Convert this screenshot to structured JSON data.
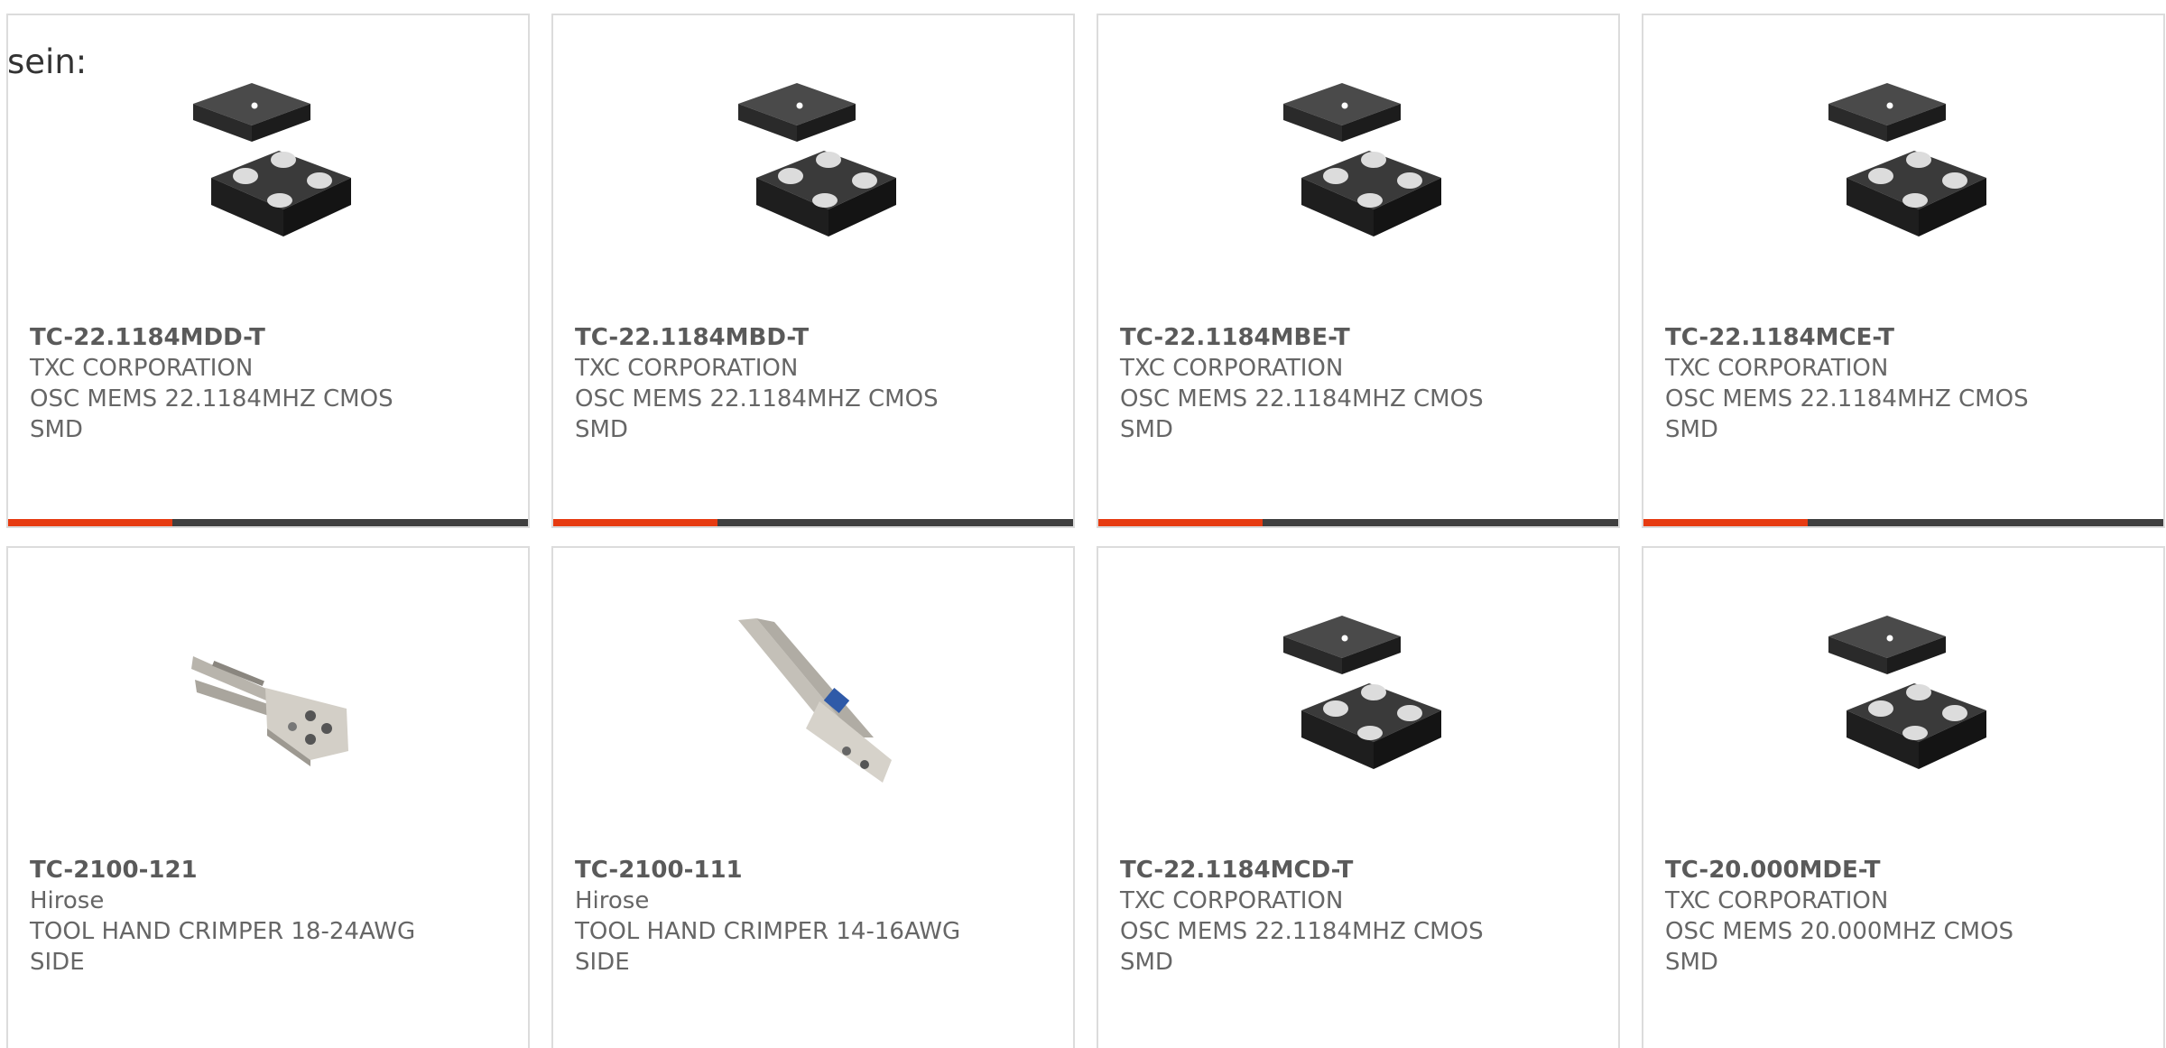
{
  "intro_text": "sein:",
  "accent_color": "#e63b11",
  "cards": [
    {
      "part": "TC-22.1184MDD-T",
      "maker": "TXC CORPORATION",
      "desc1": "OSC MEMS 22.1184MHZ CMOS",
      "desc2": "SMD",
      "image": "mems-oscillator-icon"
    },
    {
      "part": "TC-22.1184MBD-T",
      "maker": "TXC CORPORATION",
      "desc1": "OSC MEMS 22.1184MHZ CMOS",
      "desc2": "SMD",
      "image": "mems-oscillator-icon"
    },
    {
      "part": "TC-22.1184MBE-T",
      "maker": "TXC CORPORATION",
      "desc1": "OSC MEMS 22.1184MHZ CMOS",
      "desc2": "SMD",
      "image": "mems-oscillator-icon"
    },
    {
      "part": "TC-22.1184MCE-T",
      "maker": "TXC CORPORATION",
      "desc1": "OSC MEMS 22.1184MHZ CMOS",
      "desc2": "SMD",
      "image": "mems-oscillator-icon"
    },
    {
      "part": "TC-2100-121",
      "maker": "Hirose",
      "desc1": "TOOL HAND CRIMPER 18-24AWG",
      "desc2": "SIDE",
      "image": "hand-crimper-icon"
    },
    {
      "part": "TC-2100-111",
      "maker": "Hirose",
      "desc1": "TOOL HAND CRIMPER 14-16AWG",
      "desc2": "SIDE",
      "image": "hand-crimper-blue-icon"
    },
    {
      "part": "TC-22.1184MCD-T",
      "maker": "TXC CORPORATION",
      "desc1": "OSC MEMS 22.1184MHZ CMOS",
      "desc2": "SMD",
      "image": "mems-oscillator-icon"
    },
    {
      "part": "TC-20.000MDE-T",
      "maker": "TXC CORPORATION",
      "desc1": "OSC MEMS 20.000MHZ CMOS",
      "desc2": "SMD",
      "image": "mems-oscillator-icon"
    }
  ]
}
